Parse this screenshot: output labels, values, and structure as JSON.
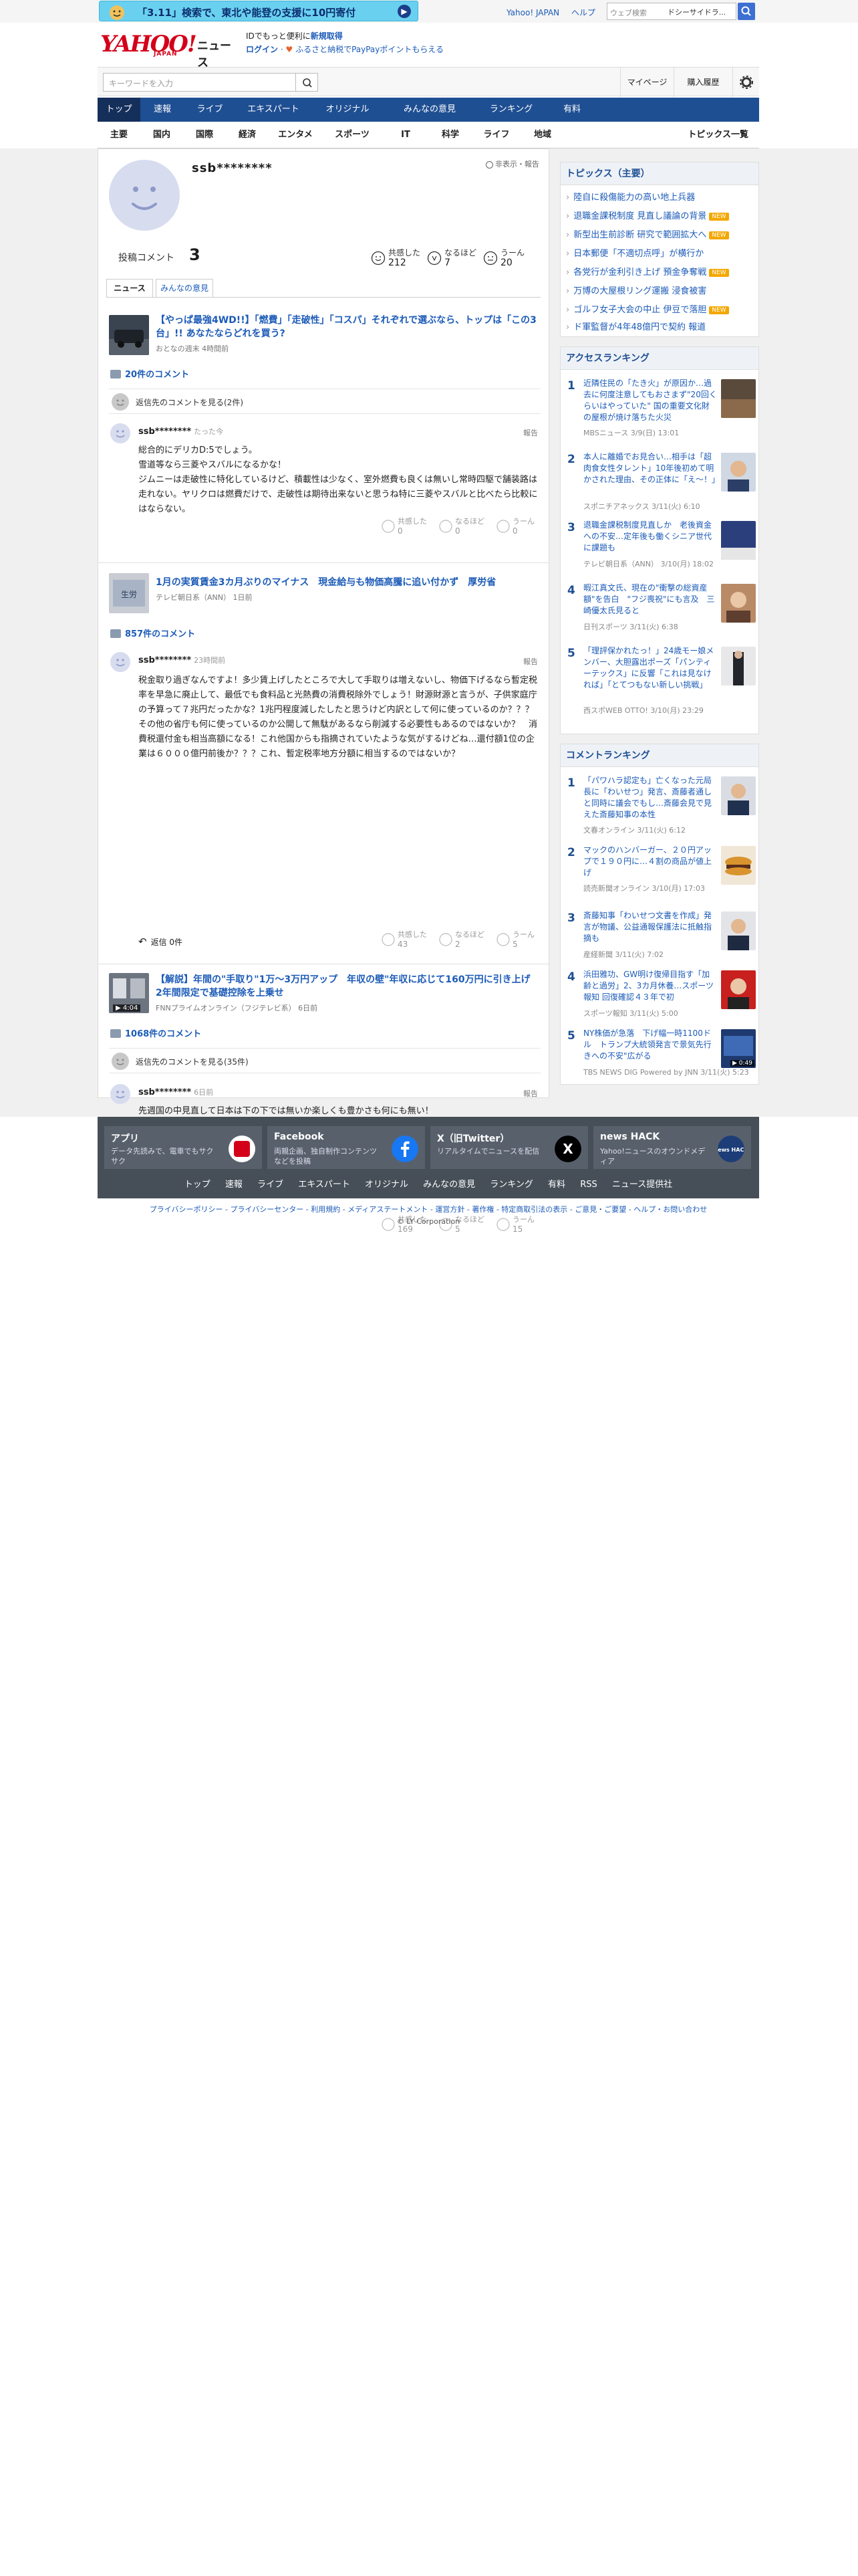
{
  "topbar": {
    "banner_text": "「3.11」検索で、東北や能登の支援に10円寄付",
    "links": [
      "Yahoo! JAPAN",
      "ヘルプ"
    ],
    "search_placeholder": "ウェブ検索",
    "search_scope": "ドシーサイドラ..."
  },
  "header": {
    "logo_main": "YAHOO!",
    "logo_sub": "JAPAN",
    "logo_service": "ニュース",
    "login_line1_prefix": "IDでもっと便利に",
    "login_line1_link": "新規取得",
    "login_link": "ログイン",
    "login_line2_suffix": "ふるさと納税でPayPayポイントもらえる"
  },
  "searchbar": {
    "placeholder": "キーワードを入力",
    "mypage": "マイページ",
    "history": "購入履歴"
  },
  "nav": {
    "items": [
      "トップ",
      "速報",
      "ライブ",
      "エキスパート",
      "オリジナル",
      "みんなの意見",
      "ランキング",
      "有料"
    ]
  },
  "subnav": {
    "items": [
      "主要",
      "国内",
      "国際",
      "経済",
      "エンタメ",
      "スポーツ",
      "IT",
      "科学",
      "ライフ",
      "地域"
    ],
    "more": "トピックス一覧"
  },
  "profile": {
    "name": "ssb********",
    "report": "非表示・報告",
    "count_label": "投稿コメント",
    "count": "3",
    "reactions": [
      {
        "label": "共感した",
        "value": "212"
      },
      {
        "label": "なるほど",
        "value": "7"
      },
      {
        "label": "うーん",
        "value": "20"
      }
    ],
    "tabs": [
      "ニュース",
      "みんなの意見"
    ]
  },
  "comments": [
    {
      "title": "【やっぱ最強4WD!!】「燃費」「走破性」「コスパ」それぞれで選ぶなら、トップは「この3台」!! あなたならどれを買う?",
      "source": "おとなの週末",
      "time": "4時間前",
      "comment_count": "20件のコメント",
      "prev_text": "返信先のコメントを見る(2件)",
      "user": "ssb********",
      "user_time": "たった今",
      "report": "報告",
      "body": "総合的にデリカD:5でしょう。\n雪道等なら三菱やスバルになるかな！\nジムニーは走破性に特化しているけど、積載性は少なく、室外燃費も良くは無いし常時四駆で舗装路は走れない。ヤリクロは燃費だけで、走破性は期待出来ないと思うね特に三菱やスバルと比べたら比較にはならない。",
      "reactions": [
        {
          "label": "共感した",
          "value": "0"
        },
        {
          "label": "なるほど",
          "value": "0"
        },
        {
          "label": "うーん",
          "value": "0"
        }
      ]
    },
    {
      "title": "1月の実質賃金3カ月ぶりのマイナス　現金給与も物価高騰に追い付かず　厚労省",
      "source": "テレビ朝日系（ANN）",
      "time": "1日前",
      "comment_count": "857件のコメント",
      "user": "ssb********",
      "user_time": "23時間前",
      "report": "報告",
      "body": "税金取り過ぎなんですよ！多少賃上げしたところで大して手取りは増えないし、物価下げるなら暫定税率を早急に廃止して、最低でも食料品と光熱費の消費税除外でしょう！財源財源と言うが、子供家庭庁の予算って７兆円だったかな？1兆円程度減したしたと思うけど内訳として何に使っているのか？？？その他の省庁も何に使っているのか公開して無駄があるなら削減する必要性もあるのではないか？　消費税還付金も相当高額になる！これ他国からも指摘されていたような気がするけどね…還付額1位の企業は６０００億円前後か？？？これ、暫定税率地方分額に相当するのではないか？",
      "reply_count": "返信 0件",
      "reactions": [
        {
          "label": "共感した",
          "value": "43"
        },
        {
          "label": "なるほど",
          "value": "2"
        },
        {
          "label": "うーん",
          "value": "5"
        }
      ]
    },
    {
      "title": "【解説】年間の\"手取り\"1万〜3万円アップ　年収の壁\"年収に応じて160万円に引き上げ　2年間限定で基礎控除を上乗せ",
      "source": "FNNプライムオンライン（フジテレビ系）",
      "time": "6日前",
      "thumb_duration": "4:04",
      "comment_count": "1068件のコメント",
      "prev_text": "返信先のコメントを見る(35件)",
      "user": "ssb********",
      "user_time": "6日前",
      "report": "報告",
      "body": "先週国の中見直して日本は下の下では無いか楽しくも豊かさも何にも無い！\nそれが政府も党の政治　自らは何でも優遇され、国の運営として成果も出ていないのに一人前の歳費　報酬で　新幹線や航空　バスといった交通費も無料クーポンで乗り放題　裏金は訳の分からない裁量でお咎め無し！やりたい放題しておいて、国民には財源財源と言い減税はしない毎月の給与明細見れば多種多様な保険税で差し引かれ、実質的な負担率で5割で手元に残るのは半分か？？？国の財源では無くて、国民一人一人の財源を増やす事を何故考えれないのか？政治与党　国会議員！",
      "reactions": [
        {
          "label": "共感した",
          "value": "169"
        },
        {
          "label": "なるほど",
          "value": "5"
        },
        {
          "label": "うーん",
          "value": "15"
        }
      ]
    }
  ],
  "topics": {
    "heading": "トピックス（主要）",
    "items": [
      {
        "text": "陸自に殺傷能力の高い地上兵器",
        "new": ""
      },
      {
        "text": "退職金課税制度 見直し議論の背景",
        "new": "NEW"
      },
      {
        "text": "新型出生前診断 研究で範囲拡大へ",
        "new": "NEW"
      },
      {
        "text": "日本郵便「不適切点呼」が横行か",
        "new": ""
      },
      {
        "text": "各党行が金利引き上げ 預金争奪戦",
        "new": "NEW"
      },
      {
        "text": "万博の大屋根リング運搬 浸食被害",
        "new": ""
      },
      {
        "text": "ゴルフ女子大会の中止 伊豆で落胆",
        "new": "NEW"
      },
      {
        "text": "ド軍監督が4年48億円で契約 報道",
        "new": ""
      }
    ]
  },
  "access_ranking": {
    "heading": "アクセスランキング",
    "items": [
      {
        "rank": "1",
        "title": "近隣住民の「たき火」が原因か…過去に何度注意してもおさまず\"20回くらいはやっていた\" 国の重要文化財の屋根が焼け落ちた火災",
        "meta": "MBSニュース 3/9(日) 13:01"
      },
      {
        "rank": "2",
        "title": "本人に離婚でお見合い…相手は「超肉食女性タレント」10年後初めて明かされた理由、その正体に「え〜！」",
        "meta": "スポニチアネックス 3/11(火) 6:10"
      },
      {
        "rank": "3",
        "title": "退職金課税制度見直しか　老後資金への不安…定年後も働くシニア世代に課題も",
        "meta": "テレビ朝日系（ANN） 3/10(月) 18:02"
      },
      {
        "rank": "4",
        "title": "暇江真文氏、現在の\"衝撃の総資産額\"を告白　\"フジ喪祝\"にも言及　三崎優太氏見ると",
        "meta": "日刊スポーツ 3/11(火) 6:38"
      },
      {
        "rank": "5",
        "title": "「理評保かれたっ！」24歳モー娘メンバー、大胆露出ポーズ「パンティーテックス」に反響「これは見なければ」「とてつもない新しい挑戦」",
        "meta": "西スポWEB OTTO! 3/10(月) 23:29"
      }
    ]
  },
  "comment_ranking": {
    "heading": "コメントランキング",
    "items": [
      {
        "rank": "1",
        "title": "「パワハラ認定も」亡くなった元局長に「わいせつ」発言、斎藤者通しと同時に議会でもし…斎藤会見で見えた斎藤知事の本性",
        "meta": "文春オンライン 3/11(火) 6:12"
      },
      {
        "rank": "2",
        "title": "マックのハンバーガー、２０円アップで１９０円に…４割の商品が値上げ",
        "meta": "読売新聞オンライン 3/10(月) 17:03"
      },
      {
        "rank": "3",
        "title": "斎藤知事「わいせつ文書を作成」発言が物議、公益通報保護法に抵触指摘も",
        "meta": "産経新聞 3/11(火) 7:02"
      },
      {
        "rank": "4",
        "title": "浜田雅功、GW明け復帰目指す「加齢と過労」2、3カ月休養…スポーツ報知 回復確認４３年で初",
        "meta": "スポーツ報知 3/11(火) 5:00"
      },
      {
        "rank": "5",
        "title": "NY株価が急落　下げ幅一時1100ドル　トランプ大統領発言で景気先行きへの不安\"広がる",
        "meta": "TBS NEWS DIG Powered by JNN 3/11(火) 5:23",
        "duration": "0:49"
      }
    ]
  },
  "footer": {
    "cards": [
      {
        "title": "アプリ",
        "desc": "データ先読みで、電車でもサクサク"
      },
      {
        "title": "Facebook",
        "desc": "両親企画、独自制作コンテンツなどを投稿"
      },
      {
        "title": "X（旧Twitter）",
        "desc": "リアルタイムでニュースを配信"
      },
      {
        "title": "news HACK",
        "desc": "Yahoo!ニュースのオウンドメディア"
      }
    ],
    "nav": [
      "トップ",
      "速報",
      "ライブ",
      "エキスパート",
      "オリジナル",
      "みんなの意見",
      "ランキング",
      "有料",
      "RSS",
      "ニュース提供社"
    ],
    "legal": "プライバシーポリシー - プライバシーセンター - 利用規約 - メディアステートメント - 運営方針 - 著作権 - 特定商取引法の表示 - ご意見・ご要望 - ヘルプ・お問い合わせ",
    "copyright": "© LY Corporation",
    "x_glyph": "X",
    "hack_glyph": "news HACK"
  }
}
